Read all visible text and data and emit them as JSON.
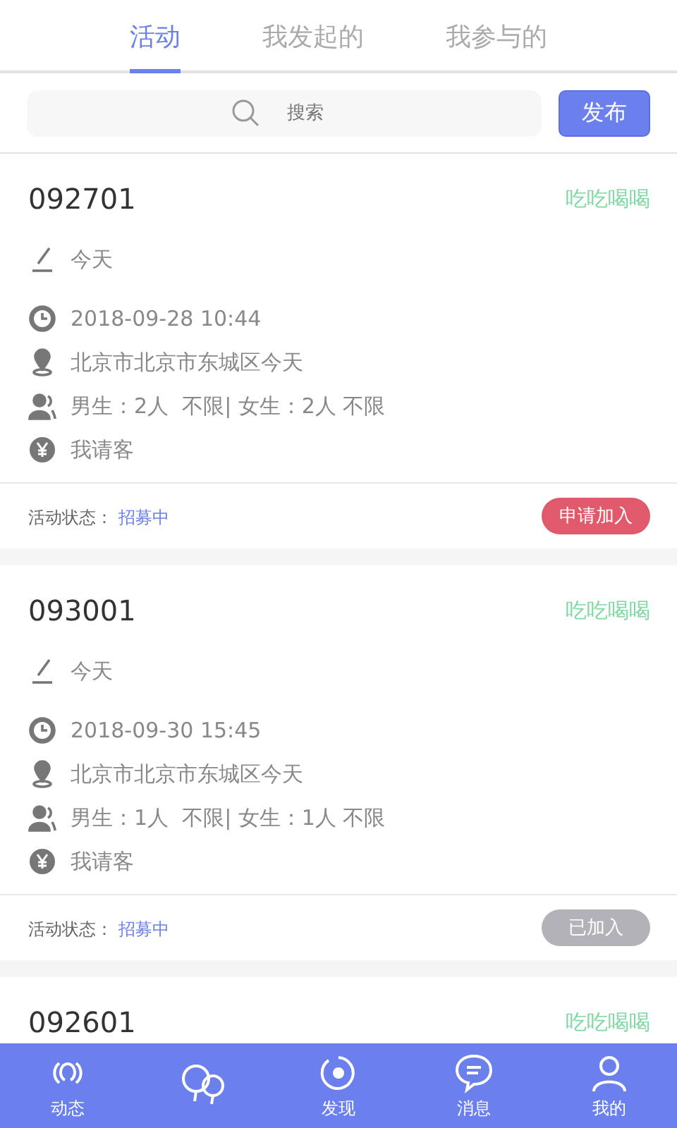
{
  "tabs": [
    {
      "label": "活动",
      "selected": true
    },
    {
      "label": "我发起的",
      "selected": false
    },
    {
      "label": "我参与的",
      "selected": false
    }
  ],
  "search": {
    "placeholder": "搜索"
  },
  "publish_button": "发布",
  "activities": [
    {
      "title": "092701",
      "category": "吃吃喝喝",
      "note": "今天",
      "time": "2018-09-28 10:44",
      "place": "北京市北京市东城区今天",
      "people": "男生：2人  不限| 女生：2人 不限",
      "payment": "我请客",
      "status_label": "活动状态：",
      "status": "招募中",
      "action": {
        "label": "申请加入",
        "kind": "apply"
      }
    },
    {
      "title": "093001",
      "category": "吃吃喝喝",
      "note": "今天",
      "time": "2018-09-30 15:45",
      "place": "北京市北京市东城区今天",
      "people": "男生：1人  不限| 女生：1人 不限",
      "payment": "我请客",
      "status_label": "活动状态：",
      "status": "招募中",
      "action": {
        "label": "已加入",
        "kind": "joined"
      }
    },
    {
      "title": "092601",
      "category": "吃吃喝喝"
    }
  ],
  "nav": [
    {
      "label": "动态"
    },
    {
      "label": "发现"
    },
    {
      "label": "消息"
    },
    {
      "label": "我的"
    }
  ]
}
